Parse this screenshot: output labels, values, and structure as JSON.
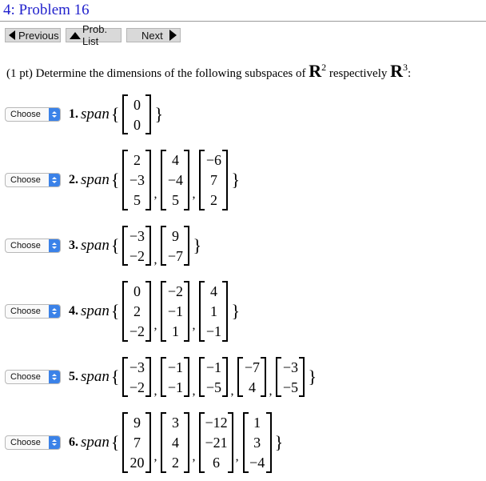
{
  "header": {
    "title": "4: Problem 16"
  },
  "nav": {
    "previous": "Previous",
    "problem_list": "Prob. List",
    "next": "Next"
  },
  "intro": {
    "pre": "(1 pt) Determine the dimensions of the following subspaces of ",
    "r": "R",
    "exp2": "2",
    "mid": " respectively ",
    "exp3": "3",
    "post": ":"
  },
  "select_label": "Choose",
  "span_word": "span",
  "problems": [
    {
      "label": "1.",
      "vectors": [
        [
          "0",
          "0"
        ]
      ]
    },
    {
      "label": "2.",
      "vectors": [
        [
          "2",
          "−3",
          "5"
        ],
        [
          "4",
          "−4",
          "5"
        ],
        [
          "−6",
          "7",
          "2"
        ]
      ]
    },
    {
      "label": "3.",
      "vectors": [
        [
          "−3",
          "−2"
        ],
        [
          "9",
          "−7"
        ]
      ]
    },
    {
      "label": "4.",
      "vectors": [
        [
          "0",
          "2",
          "−2"
        ],
        [
          "−2",
          "−1",
          "1"
        ],
        [
          "4",
          "1",
          "−1"
        ]
      ]
    },
    {
      "label": "5.",
      "vectors": [
        [
          "−3",
          "−2"
        ],
        [
          "−1",
          "−1"
        ],
        [
          "−1",
          "−5"
        ],
        [
          "−7",
          "4"
        ],
        [
          "−3",
          "−5"
        ]
      ]
    },
    {
      "label": "6.",
      "vectors": [
        [
          "9",
          "7",
          "20"
        ],
        [
          "3",
          "4",
          "2"
        ],
        [
          "−12",
          "−21",
          "6"
        ],
        [
          "1",
          "3",
          "−4"
        ]
      ]
    }
  ]
}
